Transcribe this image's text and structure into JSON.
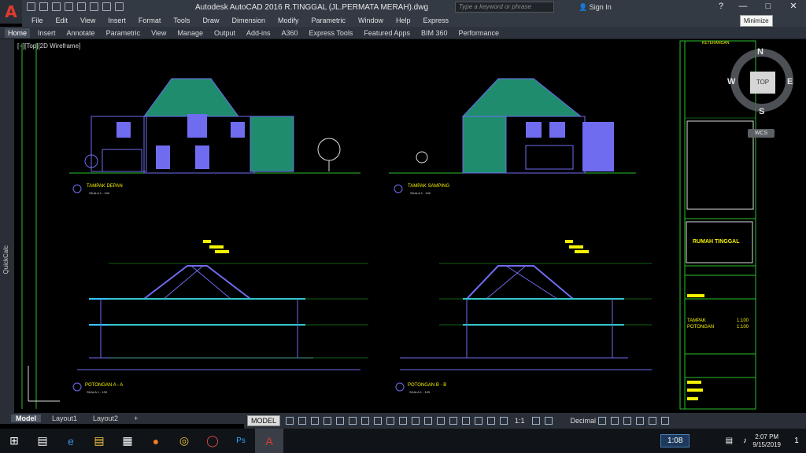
{
  "app": {
    "title": "Autodesk AutoCAD 2016    R.TINGGAL (JL.PERMATA MERAH).dwg",
    "logo_letter": "A",
    "search_placeholder": "Type a keyword or phrase",
    "sign_in": "Sign In",
    "minimize_tooltip": "Minimize"
  },
  "menu": [
    "File",
    "Edit",
    "View",
    "Insert",
    "Format",
    "Tools",
    "Draw",
    "Dimension",
    "Modify",
    "Parametric",
    "Window",
    "Help",
    "Express"
  ],
  "ribbon_tabs": [
    "Home",
    "Insert",
    "Annotate",
    "Parametric",
    "View",
    "Manage",
    "Output",
    "Add-ins",
    "A360",
    "Express Tools",
    "Featured Apps",
    "BIM 360",
    "Performance"
  ],
  "viewport": {
    "label": "[−][Top][2D Wireframe]",
    "side_palette": "QuickCalc"
  },
  "viewcube": {
    "north": "N",
    "south": "S",
    "east": "E",
    "west": "W",
    "top": "TOP",
    "wcs": "WCS"
  },
  "drawing": {
    "labels": {
      "front": "TAMPAK DEPAN",
      "side": "TAMPAK SAMPING",
      "section_a": "POTONGAN A - A",
      "section_b": "POTONGAN B - B",
      "scale": "SKALA    1 : 100"
    },
    "title_block": {
      "notes_header": "KETERANGAN",
      "project": "RUMAH TINGGAL",
      "sheet_line1": "TAMPAK",
      "sheet_line2": "POTONGAN",
      "scale1": "1:100",
      "scale2": "1:100"
    }
  },
  "layout_tabs": [
    "Model",
    "Layout1",
    "Layout2",
    "+"
  ],
  "status": {
    "model": "MODEL",
    "annotation_scale": "1:1",
    "units": "Decimal"
  },
  "taskbar": {
    "time_widget": "1:08",
    "clock_time": "2:07 PM",
    "clock_date": "9/15/2019",
    "notifications": "1"
  },
  "colors": {
    "accent_red": "#e03a2f",
    "wall_blue": "#6f6cf0",
    "roof_green": "#1f8c6e",
    "line_green": "#27c12b",
    "highlight_yellow": "#f5f200",
    "dim_red": "#ff2222",
    "beam_cyan": "#36c7ff"
  }
}
